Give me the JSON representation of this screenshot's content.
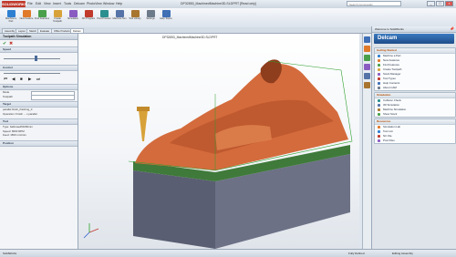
{
  "app": {
    "logo_text": "SOLIDWORKS",
    "doc_title": "DP32853_MachinedMachine3D.SLDPRT [Read only]"
  },
  "menus": [
    "File",
    "Edit",
    "View",
    "Insert",
    "Tools",
    "Delcam",
    "PhotoView",
    "Window",
    "Help"
  ],
  "search_placeholder": "Search Commands",
  "window_buttons": [
    "_",
    "□",
    "×"
  ],
  "command_tools": [
    {
      "label": "Machine a Part",
      "color": "#2f7fd1"
    },
    {
      "label": "New Feature",
      "color": "#e07a2a"
    },
    {
      "label": "Find Features",
      "color": "#4aa04a"
    },
    {
      "label": "Create Toolpath",
      "color": "#d8a23a"
    },
    {
      "label": "Simulation",
      "color": "#8a5cc2"
    },
    {
      "label": "NC Program",
      "color": "#c0392b"
    },
    {
      "label": "Post Process",
      "color": "#2b8f8f"
    },
    {
      "label": "Machine Sim",
      "color": "#5573a8"
    },
    {
      "label": "Tool Library",
      "color": "#a8752f"
    },
    {
      "label": "Settings",
      "color": "#6c7a89"
    },
    {
      "label": "Help Topics",
      "color": "#3f6fb5"
    }
  ],
  "tabs": [
    "Assembly",
    "Layout",
    "Sketch",
    "Evaluate",
    "Office Products",
    "Delcam"
  ],
  "active_tab": "Delcam",
  "left_panel": {
    "title": "Toolpath Simulation",
    "sections": [
      {
        "head": "Speed",
        "rows": []
      },
      {
        "head": "Control",
        "rows": []
      },
      {
        "head": "Options",
        "rows": [
          "Mode",
          "Toolpath"
        ]
      },
      {
        "head": "Target",
        "rows": [
          "parallel finish_finishing_0",
          "Operation: Finish ... x.parallel"
        ]
      },
      {
        "head": "Tool",
        "rows": [
          "Type: ballnosed50x50mm",
          "Speed: 8000 RPM",
          "Feed: 1500 mm/min"
        ]
      },
      {
        "head": "Position",
        "rows": []
      }
    ],
    "playback": [
      "⏮",
      "◀",
      "■",
      "▶",
      "⏭"
    ]
  },
  "viewport_title": "DP32853_MachinedMachine3D.SLDPRT",
  "right_panel": {
    "logo_text": "Delcam",
    "title": "Welcome to SolidWorks",
    "groups": [
      {
        "head": "Getting Started",
        "items": [
          "Machine a Part",
          "New Features",
          "Find Features",
          "Create Toolpath",
          "Stock Manager",
          "Tool Types",
          "Help Contents",
          "About CAM"
        ]
      },
      {
        "head": "Simulation",
        "items": [
          "Collision Check",
          "3D Simulation",
          "Machine Simulation",
          "Show Stock"
        ]
      },
      {
        "head": "Resources",
        "items": [
          "Simulation Lab",
          "Tool List",
          "NC File",
          "Post Files"
        ]
      }
    ]
  },
  "statusbar": {
    "left": "SolidWorks",
    "mid": "Fully Defined",
    "right": "Editing Assembly"
  },
  "colors": {
    "part_orange": "#d46b3c",
    "part_dark": "#7a3a1f",
    "stock_green": "#3f7a3a",
    "block_gray": "#5a5e72",
    "outline_green": "#2ca02c"
  },
  "icons": [
    "solidworks-logo-icon",
    "pushpin-icon",
    "play-icon",
    "delcam-logo-icon",
    "axis-triad-icon"
  ]
}
